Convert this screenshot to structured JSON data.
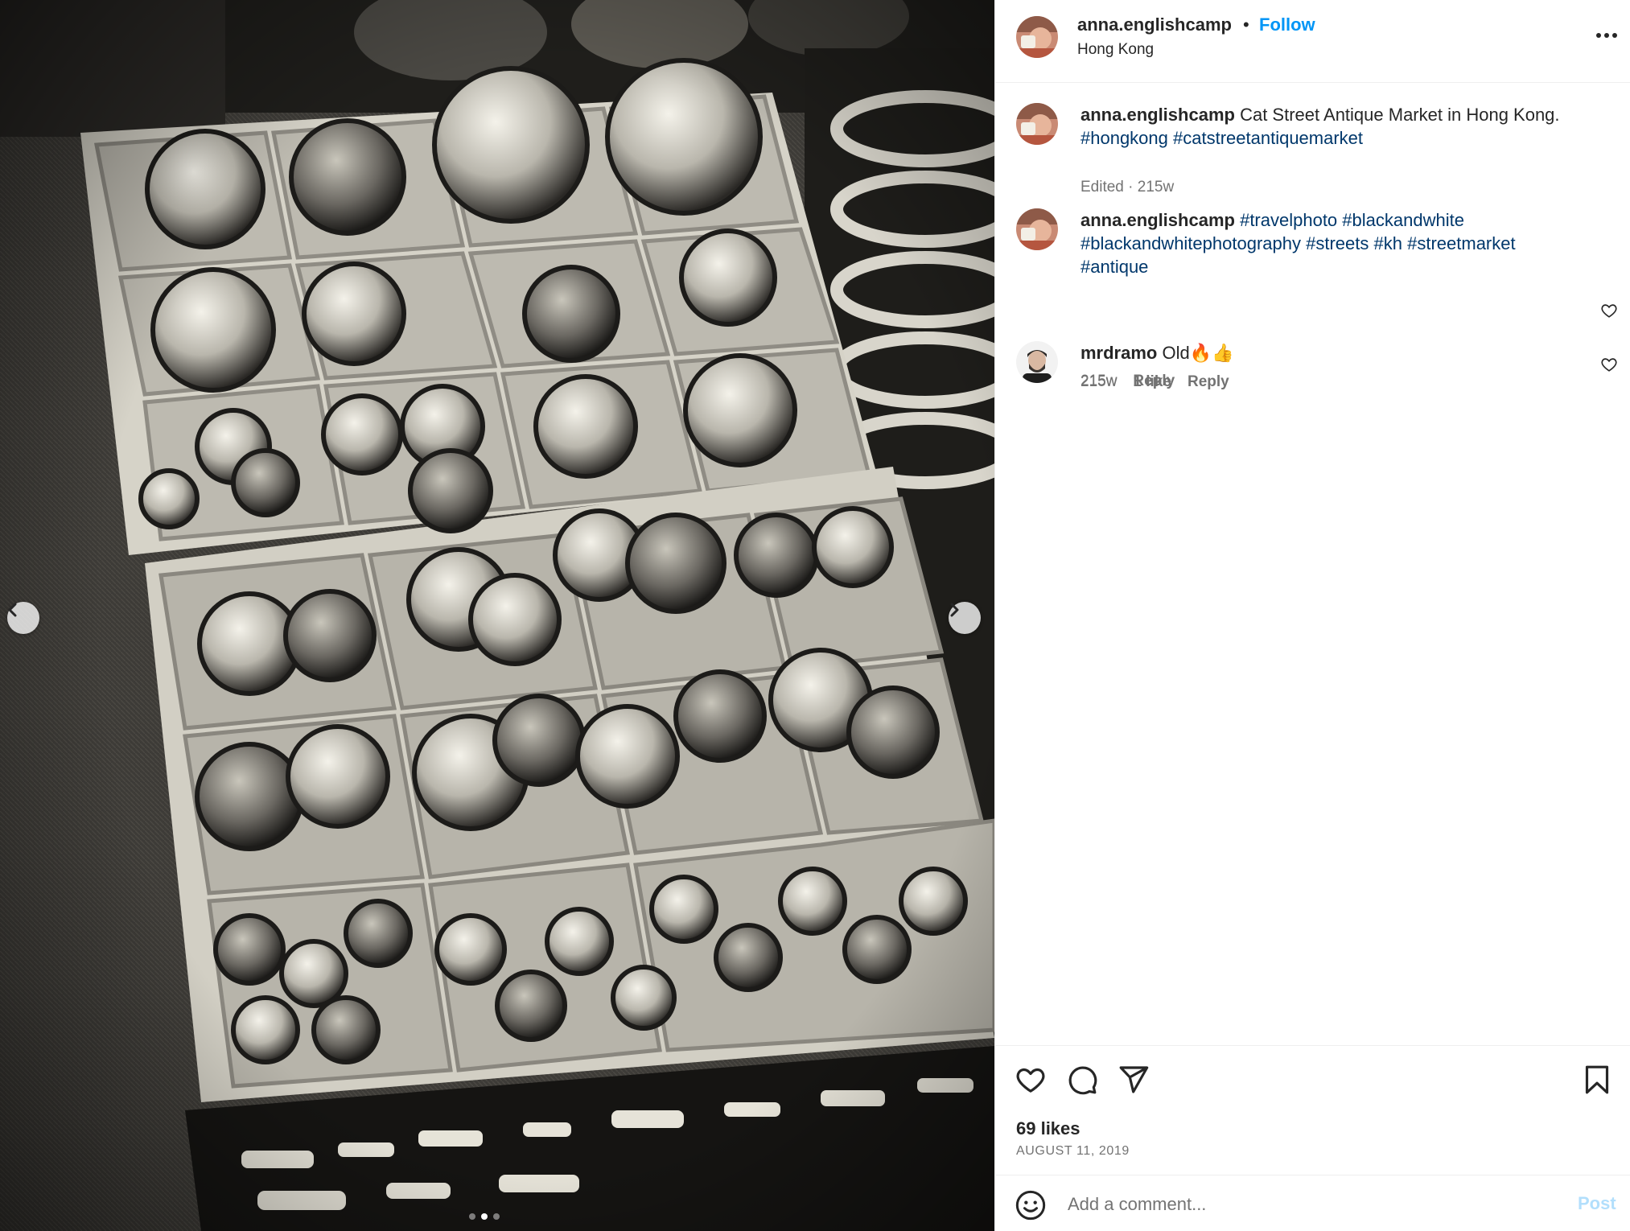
{
  "post": {
    "photo_alt": "Black and white photo of trays filled with antique pocket watches",
    "carousel": {
      "total": 3,
      "active": 2
    }
  },
  "header": {
    "username": "anna.englishcamp",
    "separator": "•",
    "follow_label": "Follow",
    "location": "Hong Kong"
  },
  "caption": {
    "username": "anna.englishcamp",
    "text": "Cat Street Antique Market in Hong Kong.",
    "tags": [
      "#hongkong",
      "#catstreetantiquemarket"
    ],
    "meta": "Edited · 215w"
  },
  "comments": [
    {
      "username": "anna.englishcamp",
      "text": "",
      "tags": [
        "#travelphoto",
        "#blackandwhite",
        "#blackandwhitephotography",
        "#streets",
        "#kh",
        "#streetmarket",
        "#antique"
      ],
      "time": "215w",
      "likes": "",
      "reply_label": "Reply"
    },
    {
      "username": "mrdramo",
      "text": "Old🔥👍",
      "tags": [],
      "time": "215w",
      "likes": "1 like",
      "reply_label": "Reply"
    }
  ],
  "footer": {
    "likes": "69 likes",
    "date": "AUGUST 11, 2019",
    "comment_placeholder": "Add a comment...",
    "post_label": "Post"
  },
  "colors": {
    "accent": "#0095f6",
    "hashtag": "#00376b",
    "muted": "#737373",
    "post_disabled": "#b2dffc"
  },
  "icons": {
    "more": "more-options-icon",
    "like": "heart-icon",
    "comment": "comment-icon",
    "share": "share-icon",
    "save": "bookmark-icon",
    "emoji": "emoji-icon",
    "prev": "chevron-left-icon",
    "next": "chevron-right-icon"
  }
}
